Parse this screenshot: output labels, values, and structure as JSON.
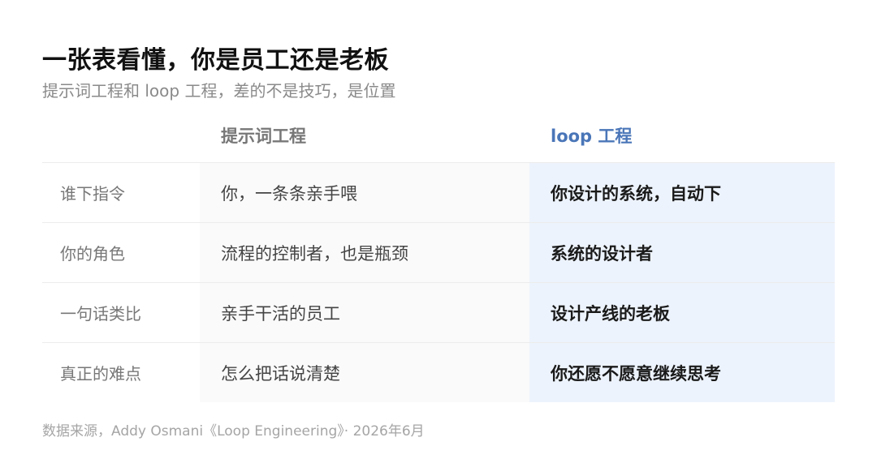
{
  "title": "一张表看懂，你是员工还是老板",
  "subtitle": "提示词工程和 loop 工程，差的不是技巧，是位置",
  "table": {
    "headers": {
      "label": "",
      "prompt": "提示词工程",
      "loop": "loop 工程"
    },
    "rows": [
      {
        "label": "谁下指令",
        "prompt": "你，一条条亲手喂",
        "loop": "你设计的系统，自动下"
      },
      {
        "label": "你的角色",
        "prompt": "流程的控制者，也是瓶颈",
        "loop": "系统的设计者"
      },
      {
        "label": "一句话类比",
        "prompt": "亲手干活的员工",
        "loop": "设计产线的老板"
      },
      {
        "label": "真正的难点",
        "prompt": "怎么把话说清楚",
        "loop": "你还愿不愿意继续思考"
      }
    ]
  },
  "footer": "数据来源，Addy Osmani《Loop Engineering》· 2026年6月",
  "colors": {
    "accent": "#4a76b8",
    "loop_column_bg": "#edf3fc",
    "prompt_column_bg": "#fafafa"
  }
}
